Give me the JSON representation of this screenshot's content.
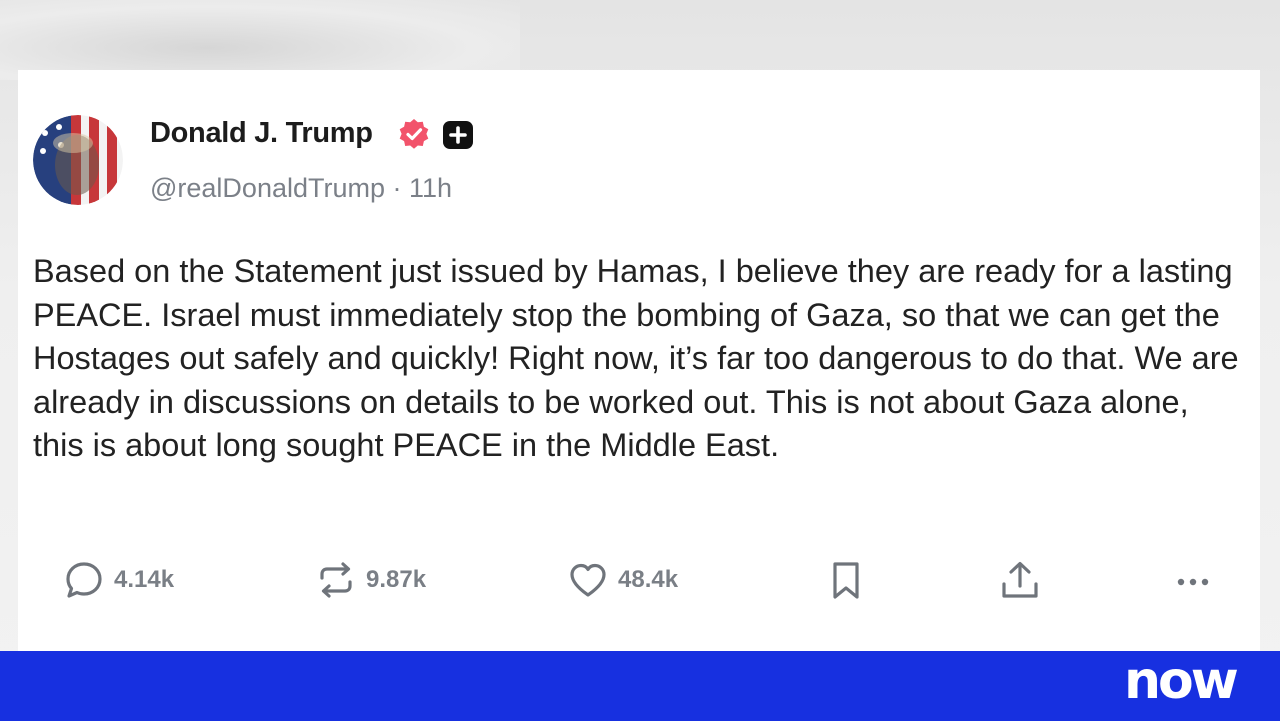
{
  "post": {
    "display_name": "Donald J. Trump",
    "handle": "@realDonaldTrump",
    "separator": "·",
    "time_ago": "11h",
    "body": "Based on the Statement just issued by Hamas, I believe they are ready for a lasting PEACE. Israel must immediately stop the bombing of Gaza, so that we can get the Hostages out safely and quickly! Right now, it’s far too dangerous to do that. We are already in discussions on details to be worked out. This is not about Gaza alone, this is about long sought PEACE in the Middle East.",
    "badges": {
      "verified_icon": "verified-check-icon",
      "verified_color": "#f2536b",
      "plus_icon": "plus-icon"
    }
  },
  "actions": {
    "reply": {
      "icon": "reply-bubble-icon",
      "count": "4.14k"
    },
    "repost": {
      "icon": "repost-icon",
      "count": "9.87k"
    },
    "like": {
      "icon": "heart-icon",
      "count": "48.4k"
    },
    "bookmark": {
      "icon": "bookmark-icon"
    },
    "share": {
      "icon": "share-upload-icon"
    },
    "more": {
      "icon": "more-dots-icon"
    }
  },
  "broadcast": {
    "logo_text": "now",
    "bar_color": "#1730e0"
  }
}
